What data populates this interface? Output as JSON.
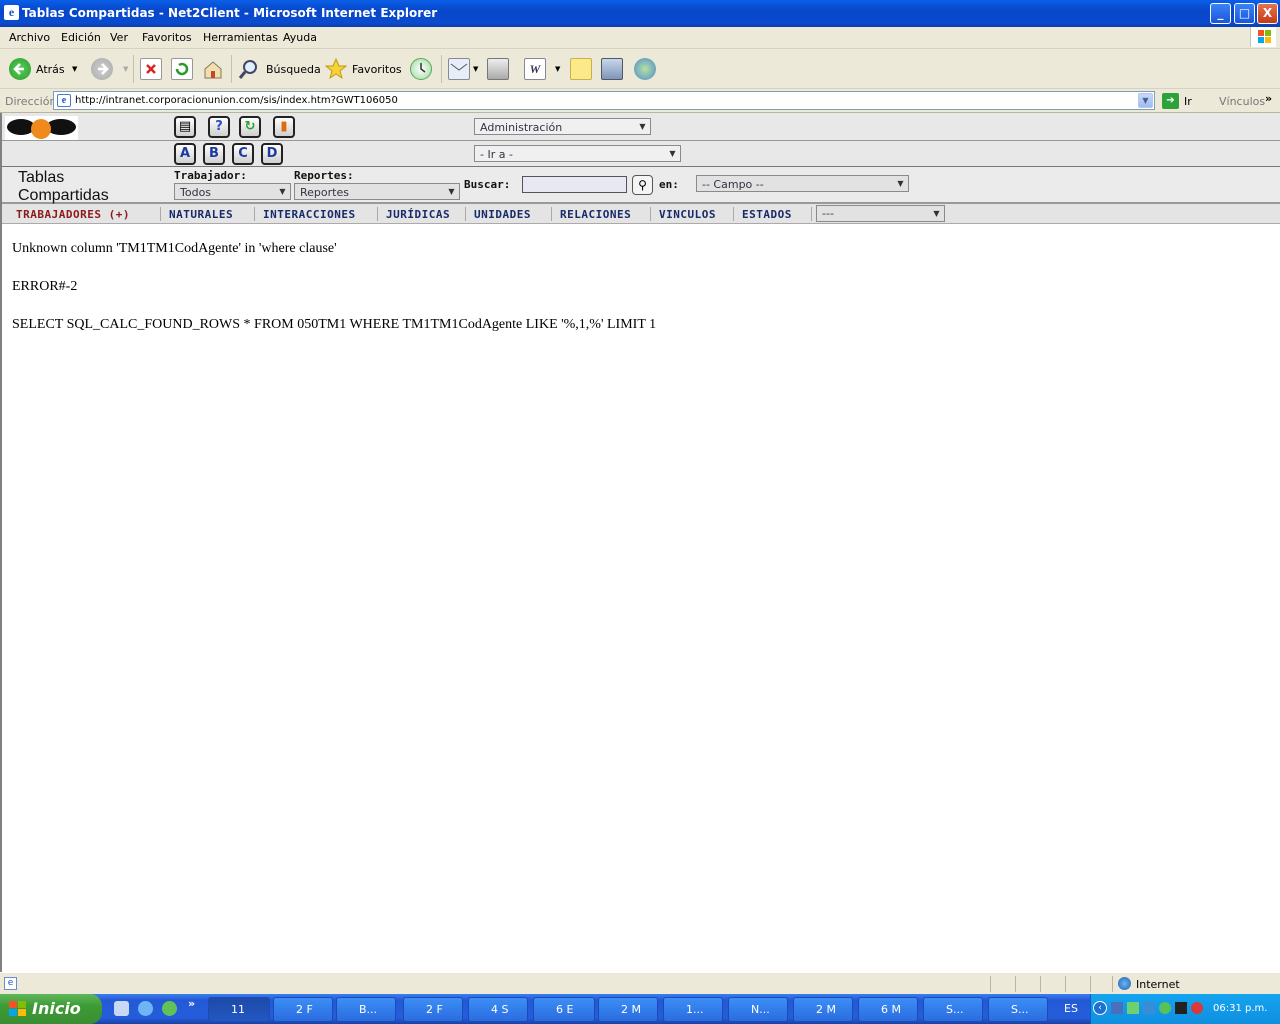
{
  "window": {
    "title": "Tablas Compartidas - Net2Client - Microsoft Internet Explorer",
    "min_label": "_",
    "max_label": "□",
    "close_label": "X"
  },
  "menu": [
    "Archivo",
    "Edición",
    "Ver",
    "Favoritos",
    "Herramientas",
    "Ayuda"
  ],
  "toolbar": {
    "back_label": "Atrás",
    "search_label": "Búsqueda",
    "favorites_label": "Favoritos"
  },
  "address": {
    "label": "Dirección",
    "url": "http://intranet.corporacionunion.com/sis/index.htm?GWT106050",
    "go_label": "Ir",
    "links_label": "Vínculos"
  },
  "app": {
    "logo_text": "N2C",
    "module_select": "Administración",
    "goto_select": "- Ir a -",
    "letter_buttons": [
      "A",
      "B",
      "C",
      "D"
    ],
    "page_title_line1": "Tablas",
    "page_title_line2": "Compartidas",
    "trabajador_label": "Trabajador:",
    "trabajador_value": "Todos",
    "reportes_label": "Reportes:",
    "reportes_value": "Reportes",
    "buscar_label": "Buscar:",
    "buscar_value": "",
    "en_label": "en:",
    "campo_value": "-- Campo --"
  },
  "nav_tabs": [
    {
      "label": "TRABAJADORES  (+)",
      "active": true
    },
    {
      "label": "NATURALES"
    },
    {
      "label": "INTERACCIONES"
    },
    {
      "label": "JURÍDICAS"
    },
    {
      "label": "UNIDADES"
    },
    {
      "label": "RELACIONES"
    },
    {
      "label": "VINCULOS"
    },
    {
      "label": "ESTADOS"
    }
  ],
  "nav_select": "---",
  "content": {
    "error_message": "Unknown column 'TM1TM1CodAgente' in 'where clause'",
    "error_code": "ERROR#-2",
    "sql": "SELECT SQL_CALC_FOUND_ROWS * FROM 050TM1 WHERE TM1TM1CodAgente LIKE '%,1,%' LIMIT 1"
  },
  "status": {
    "zone": "Internet"
  },
  "taskbar": {
    "start_label": "Inicio",
    "tasks": [
      "11",
      "2 F",
      "B...",
      "2 F",
      "4 S",
      "6 E",
      "2 M",
      "1...",
      "N...",
      "2 M",
      "6 M",
      "S...",
      "S..."
    ],
    "lang": "ES",
    "clock": "06:31 p.m."
  },
  "colors": {
    "title_blue": "#0a4bd0",
    "active_tab": "#8b1a1a",
    "tab_text": "#172a6a"
  }
}
